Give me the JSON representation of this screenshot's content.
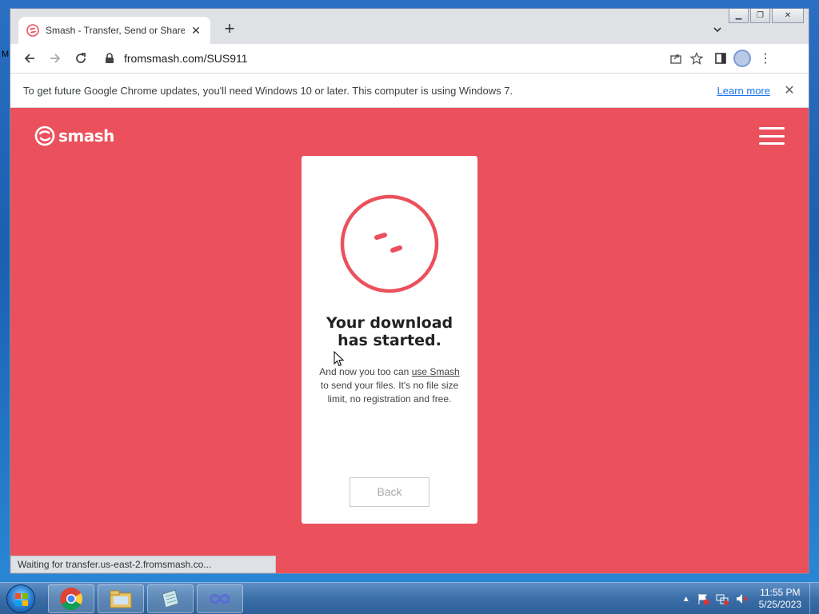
{
  "desktop": {
    "edge_label": "M"
  },
  "browser": {
    "tab_title": "Smash - Transfer, Send or Share",
    "url": "fromsmash.com/SUS911",
    "infobar_message": "To get future Google Chrome updates, you'll need Windows 10 or later. This computer is using Windows 7.",
    "infobar_link": "Learn more",
    "status_text": "Waiting for transfer.us-east-2.fromsmash.co..."
  },
  "page": {
    "logo_text": "smash",
    "card_title_line1": "Your download",
    "card_title_line2": "has started.",
    "text_before_link": "And now you too can ",
    "link_text": "use Smash",
    "text_after_link": " to send your files. It's no file size limit, no registration and free.",
    "back_button": "Back"
  },
  "taskbar": {
    "apps": [
      "chrome-icon",
      "explorer-icon",
      "notepad-icon",
      "app-icon"
    ],
    "time": "11:55 PM",
    "date": "5/25/2023"
  },
  "colors": {
    "brand": "#ea515d",
    "link": "#1a73e8"
  }
}
